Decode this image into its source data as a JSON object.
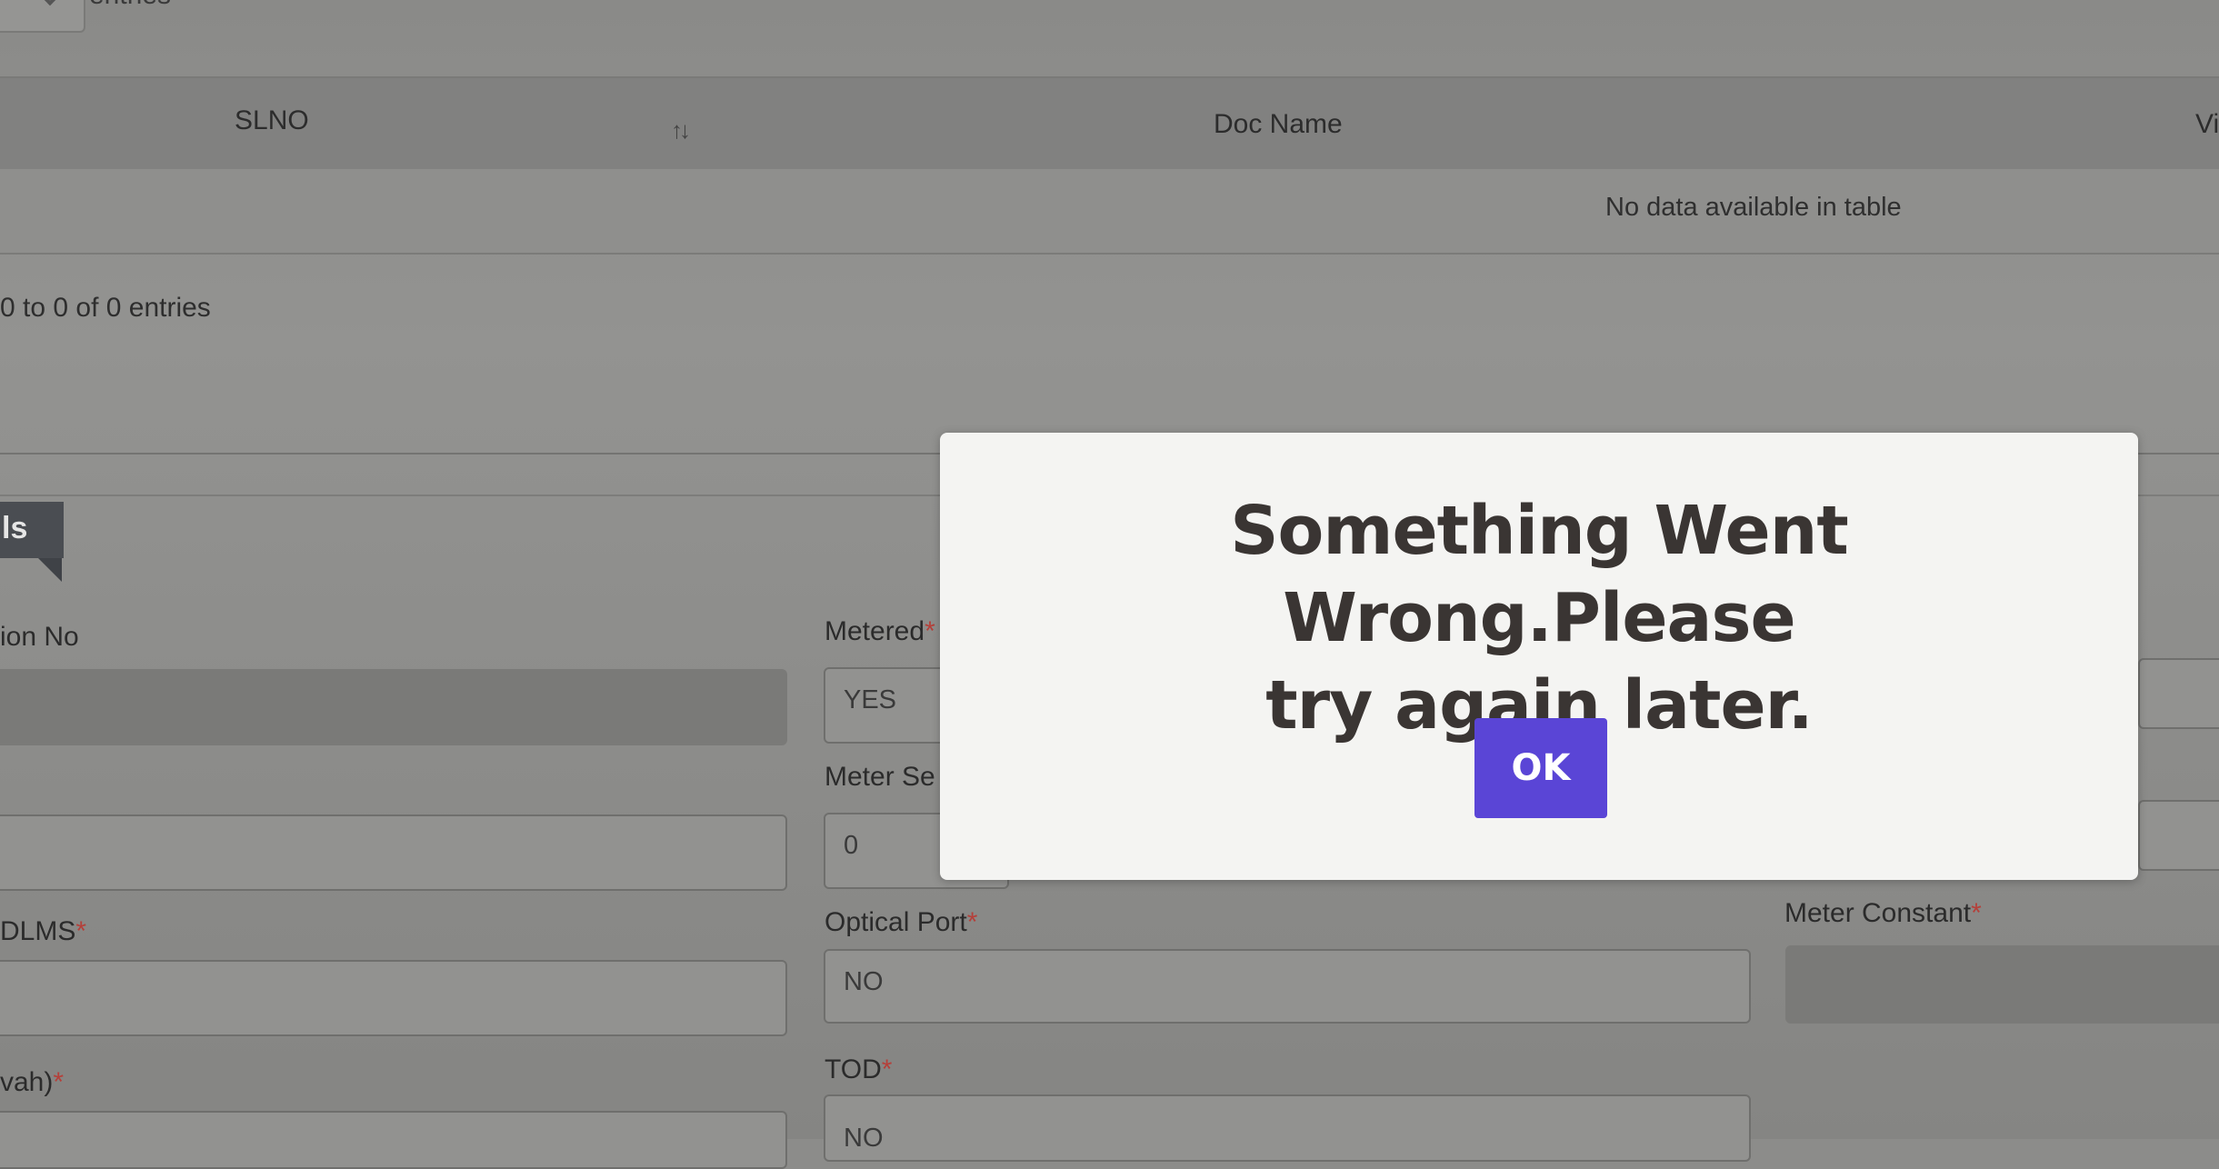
{
  "table": {
    "length_suffix": "entries",
    "columns": [
      "SLNO",
      "Doc Name",
      "Vi"
    ],
    "sort_indicator": "↑↓",
    "empty_message": "No data available in table",
    "info": "0 to 0 of 0 entries"
  },
  "section": {
    "badge_label": "ls"
  },
  "form": {
    "connection_no": {
      "label": "ion No",
      "value": ""
    },
    "metered": {
      "label": "Metered",
      "required_mark": "*",
      "value": "YES"
    },
    "field_left_2": {
      "value": ""
    },
    "meter_serial": {
      "label": "Meter Se",
      "value": "0"
    },
    "dlms": {
      "label": "DLMS",
      "required_mark": "*",
      "value": ""
    },
    "optical_port": {
      "label": "Optical Port",
      "required_mark": "*",
      "value": "NO"
    },
    "meter_constant": {
      "label": "Meter Constant",
      "required_mark": "*",
      "value": ""
    },
    "kvah": {
      "label": "vah)",
      "required_mark": "*"
    },
    "tod": {
      "label": "TOD",
      "required_mark": "*",
      "value": "NO"
    }
  },
  "modal": {
    "message_line1": "Something Went Wrong.Please",
    "message_line2": "try again later.",
    "ok_label": "OK",
    "ok_color": "#5a45d6"
  }
}
